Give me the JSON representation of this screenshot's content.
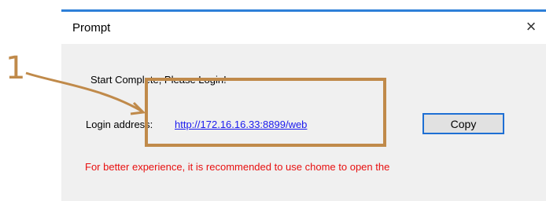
{
  "dialog": {
    "title": "Prompt",
    "close_symbol": "×",
    "start_message": "Start Complete, Please Login!",
    "login_label": "Login address:",
    "login_url": "http://172.16.16.33:8899/web",
    "copy_label": "Copy",
    "warning": "For better experience, it is recommended to use chome to open the"
  },
  "annotation": {
    "number": "1",
    "color": "#c08a4a"
  },
  "colors": {
    "title_accent": "#2d7fd8",
    "link": "#1a1aee",
    "warning": "#e81010",
    "button_border": "#1e6fd4"
  }
}
